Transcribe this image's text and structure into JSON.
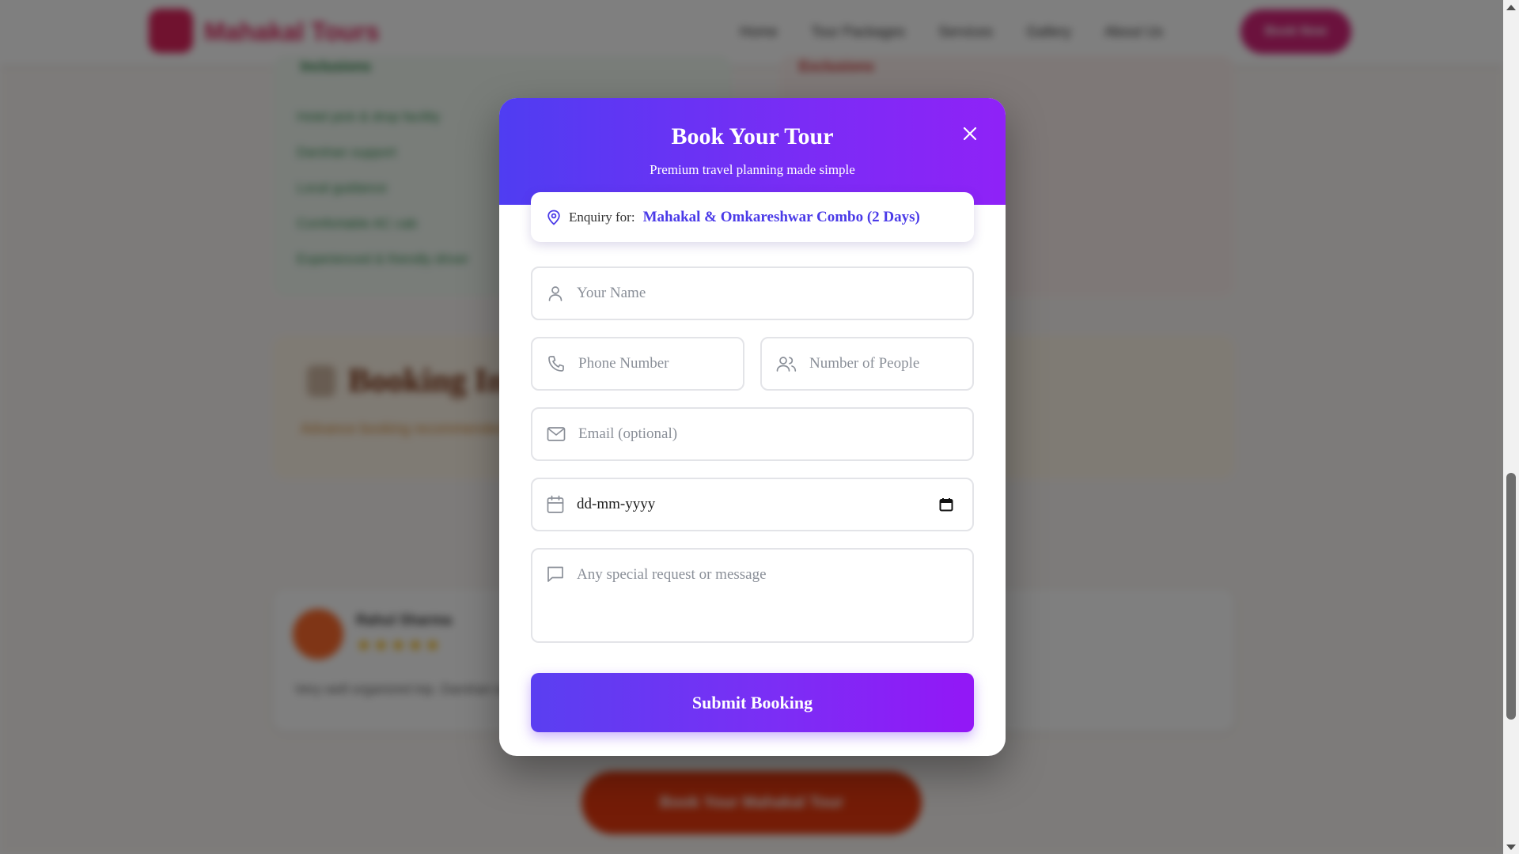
{
  "background": {
    "logo": {
      "name": "Mahakal",
      "accent": "Tours"
    },
    "nav_links": [
      "Home",
      "Tour Packages",
      "Services",
      "Gallery",
      "About Us"
    ],
    "nav_cta": "Book Now",
    "included_title": "Inclusions",
    "excluded_title": "Exclusions",
    "included_items": [
      "Hotel pick & drop facility",
      "Darshan support",
      "Local guidance",
      "Comfortable AC cab",
      "Experienced & friendly driver"
    ],
    "booking_title": "Booking Info",
    "booking_sub": "Advance booking recommended for hassle-free darshan",
    "review": {
      "name": "Rahul Sharma",
      "stars": "★★★★★",
      "text": "Very well organized trip. Darshan was smooth and the driver was very cooperative throughout the journey."
    },
    "bottom_cta": "Book Your Mahakal Tour"
  },
  "modal": {
    "title": "Book Your Tour",
    "subtitle": "Premium travel planning made simple",
    "close_icon": "close-icon",
    "enquiry": {
      "label": "Enquiry for:",
      "value": "Mahakal & Omkareshwar Combo (2 Days)",
      "icon": "map-pin-icon"
    },
    "fields": {
      "name": {
        "placeholder": "Your Name",
        "icon": "user-icon"
      },
      "phone": {
        "placeholder": "Phone Number",
        "icon": "phone-icon"
      },
      "people": {
        "placeholder": "Number of People",
        "icon": "users-icon"
      },
      "email": {
        "placeholder": "Email (optional)",
        "icon": "mail-icon"
      },
      "date": {
        "value": "dd-mm-yyyy",
        "icon": "calendar-icon"
      },
      "message": {
        "placeholder": "Any special request or message",
        "icon": "message-icon"
      }
    },
    "submit_label": "Submit Booking"
  },
  "colors": {
    "brand_gradient_start": "#4f3df2",
    "brand_gradient_end": "#8f22f7",
    "enquiry_text": "#4a3ae8",
    "placeholder": "#8a8f98",
    "border": "#e3e4e8"
  }
}
